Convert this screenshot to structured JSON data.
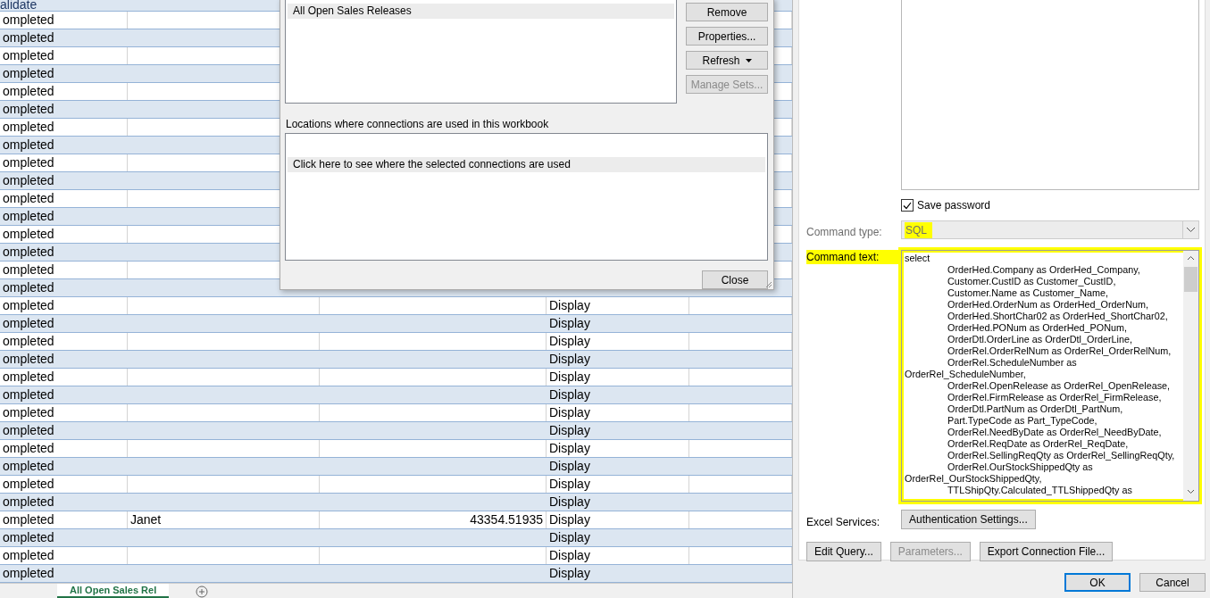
{
  "sheet": {
    "header": "alidate",
    "rows": [
      {
        "status": "ompleted"
      },
      {
        "status": "ompleted"
      },
      {
        "status": "ompleted"
      },
      {
        "status": "ompleted"
      },
      {
        "status": "ompleted"
      },
      {
        "status": "ompleted"
      },
      {
        "status": "ompleted"
      },
      {
        "status": "ompleted"
      },
      {
        "status": "ompleted"
      },
      {
        "status": "ompleted"
      },
      {
        "status": "ompleted"
      },
      {
        "status": "ompleted"
      },
      {
        "status": "ompleted"
      },
      {
        "status": "ompleted"
      },
      {
        "status": "ompleted"
      },
      {
        "status": "ompleted"
      },
      {
        "status": "ompleted",
        "col_4": "Display"
      },
      {
        "status": "ompleted",
        "col_4": "Display"
      },
      {
        "status": "ompleted",
        "col_4": "Display"
      },
      {
        "status": "ompleted",
        "col_4": "Display"
      },
      {
        "status": "ompleted",
        "col_4": "Display"
      },
      {
        "status": "ompleted",
        "col_4": "Display"
      },
      {
        "status": "ompleted",
        "col_4": "Display"
      },
      {
        "status": "ompleted",
        "col_4": "Display"
      },
      {
        "status": "ompleted",
        "col_4": "Display"
      },
      {
        "status": "ompleted",
        "col_4": "Display"
      },
      {
        "status": "ompleted",
        "col_4": "Display"
      },
      {
        "status": "ompleted",
        "col_4": "Display"
      },
      {
        "status": "ompleted",
        "col_2": "Janet",
        "col_3": "43354.51935",
        "col_4": "Display"
      },
      {
        "status": "ompleted",
        "col_4": "Display"
      },
      {
        "status": "ompleted",
        "col_4": "Display"
      },
      {
        "status": "ompleted",
        "col_4": "Display"
      }
    ],
    "tab": "All Open Sales Rel"
  },
  "connections_dialog": {
    "connections": [
      {
        "label": "All Open Sales Releases",
        "selected": true
      }
    ],
    "buttons": [
      {
        "label": "Remove",
        "kind": "plain",
        "disabled": false
      },
      {
        "label": "Properties...",
        "kind": "plain",
        "disabled": false
      },
      {
        "label": "Refresh",
        "kind": "split",
        "disabled": false
      },
      {
        "label": "Manage Sets...",
        "kind": "plain",
        "disabled": true
      }
    ],
    "locations_label": "Locations where connections are used in this workbook",
    "locations": [
      {
        "label": "Click here to see where the selected connections are used",
        "selected": true
      }
    ],
    "close_button": "Close"
  },
  "properties_dialog": {
    "save_password": {
      "label": "Save password",
      "checked": true
    },
    "command_type": {
      "label": "Command type:",
      "value": "SQL",
      "disabled": true,
      "highlighted": true
    },
    "command_text": {
      "label": "Command text:",
      "highlighted": true,
      "value": "select\n\tOrderHed.Company as OrderHed_Company,\n\tCustomer.CustID as Customer_CustID,\n\tCustomer.Name as Customer_Name,\n\tOrderHed.OrderNum as OrderHed_OrderNum,\n\tOrderHed.ShortChar02 as OrderHed_ShortChar02,\n\tOrderHed.PONum as OrderHed_PONum,\n\tOrderDtl.OrderLine as OrderDtl_OrderLine,\n\tOrderRel.OrderRelNum as OrderRel_OrderRelNum,\n\tOrderRel.ScheduleNumber as\nOrderRel_ScheduleNumber,\n\tOrderRel.OpenRelease as OrderRel_OpenRelease,\n\tOrderRel.FirmRelease as OrderRel_FirmRelease,\n\tOrderDtl.PartNum as OrderDtl_PartNum,\n\tPart.TypeCode as Part_TypeCode,\n\tOrderRel.NeedByDate as OrderRel_NeedByDate,\n\tOrderRel.ReqDate as OrderRel_ReqDate,\n\tOrderRel.SellingReqQty as OrderRel_SellingReqQty,\n\tOrderRel.OurStockShippedQty as\nOrderRel_OurStockShippedQty,\n\tTTLShipQty.Calculated_TTLShippedQty as"
    },
    "excel_services": {
      "label": "Excel Services:",
      "button": "Authentication Settings..."
    },
    "buttons": [
      {
        "label": "Edit Query...",
        "disabled": false
      },
      {
        "label": "Parameters...",
        "disabled": true
      },
      {
        "label": "Export Connection File...",
        "disabled": false
      }
    ],
    "footer": [
      {
        "label": "OK",
        "default": true
      },
      {
        "label": "Cancel",
        "default": false
      }
    ]
  }
}
